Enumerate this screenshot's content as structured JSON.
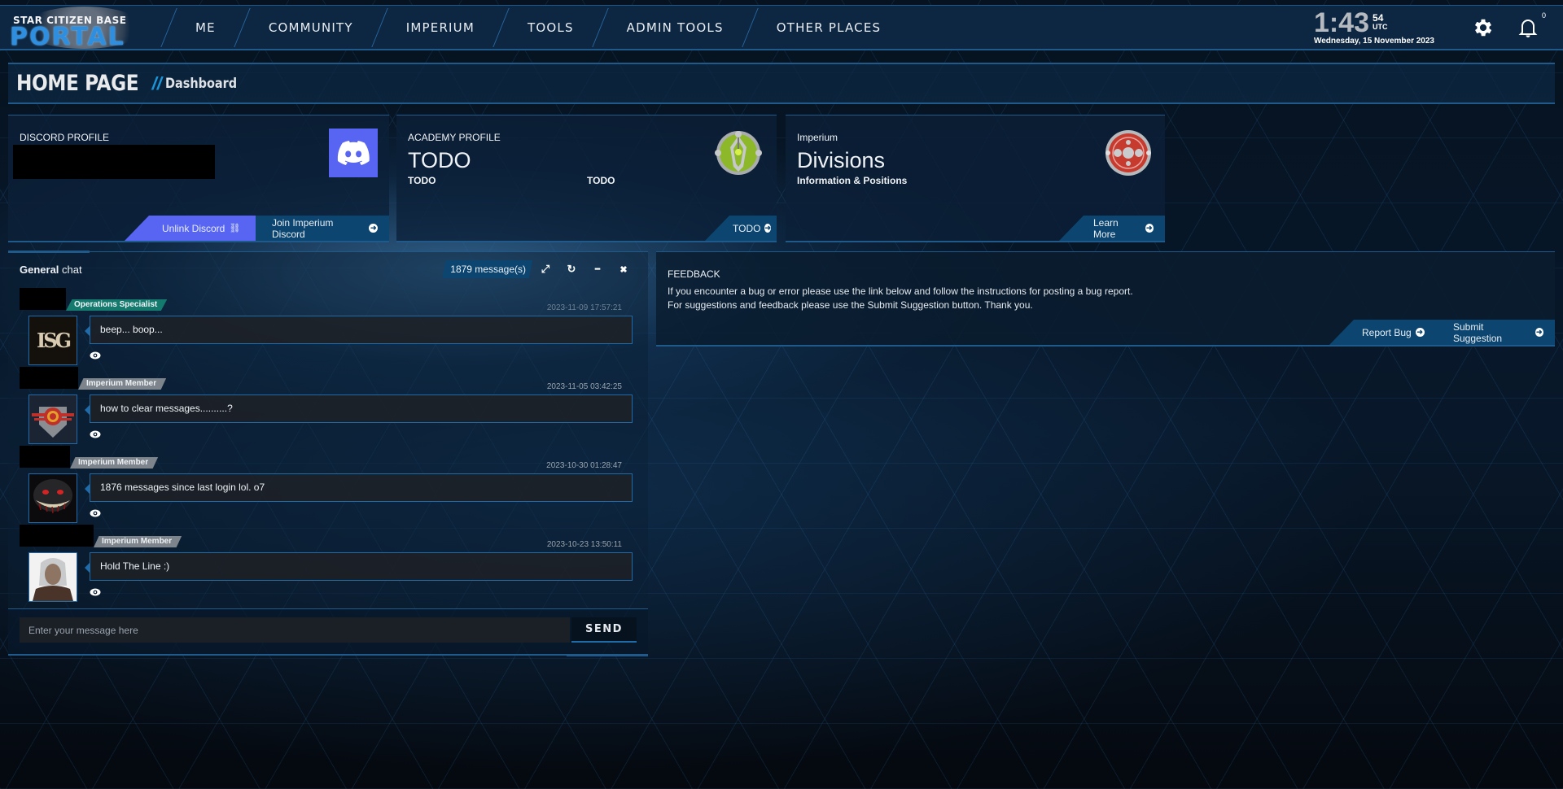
{
  "nav": {
    "logo_top": "STAR CITIZEN BASE",
    "logo_main": "PORTAL",
    "items": [
      {
        "label": "ME"
      },
      {
        "label": "COMMUNITY"
      },
      {
        "label": "IMPERIUM"
      },
      {
        "label": "TOOLS"
      },
      {
        "label": "ADMIN TOOLS"
      },
      {
        "label": "OTHER PLACES"
      }
    ],
    "clock": {
      "hm": "1:43",
      "seconds": "54",
      "tz": "UTC",
      "date": "Wednesday, 15 November 2023"
    },
    "settings_icon": "gear-icon",
    "notifications_icon": "bell-icon",
    "notification_count": "0"
  },
  "header": {
    "title": "HOME PAGE",
    "separator": "//",
    "subtitle": "Dashboard"
  },
  "cards": {
    "discord": {
      "label": "DISCORD PROFILE",
      "icon": "discord-icon",
      "buttons": [
        {
          "label": "Unlink Discord",
          "icon": "unlink-icon"
        },
        {
          "label": "Join Imperium Discord",
          "icon": "arrow-circle-right-icon"
        }
      ]
    },
    "academy": {
      "label": "ACADEMY PROFILE",
      "big": "TODO",
      "sub_left": "TODO",
      "sub_right": "TODO",
      "icon": "academy-emblem-icon",
      "button": {
        "label": "TODO",
        "icon": "arrow-circle-right-icon"
      }
    },
    "divisions": {
      "label": "Imperium",
      "big": "Divisions",
      "sub": "Information & Positions",
      "icon": "divisions-emblem-icon",
      "button": {
        "label": "Learn More",
        "icon": "arrow-circle-right-icon"
      }
    }
  },
  "chat": {
    "title_bold": "General",
    "title_rest": " chat",
    "message_count": "1879 message(s)",
    "tools": [
      {
        "name": "expand-icon",
        "glyph": "⤢"
      },
      {
        "name": "refresh-icon",
        "glyph": "↻"
      },
      {
        "name": "minimize-icon",
        "glyph": "━"
      },
      {
        "name": "close-icon",
        "glyph": "✖"
      }
    ],
    "messages": [
      {
        "role": "Operations Specialist",
        "role_color": "#157a6e",
        "time": "2023-11-09 17:57:21",
        "text": "beep... boop...",
        "avatar": "avatar-isg-logo"
      },
      {
        "role": "Imperium Member",
        "role_color": "#7d848b",
        "time": "2023-11-05 03:42:25",
        "text": "how to clear messages..........?",
        "avatar": "avatar-imperium-shield"
      },
      {
        "role": "Imperium Member",
        "role_color": "#7d848b",
        "time": "2023-10-30 01:28:47",
        "text": "1876 messages since last login lol. o7",
        "avatar": "avatar-grinning-cat"
      },
      {
        "role": "Imperium Member",
        "role_color": "#7d848b",
        "time": "2023-10-23 13:50:11",
        "text": "Hold The Line :)",
        "avatar": "avatar-geralt"
      }
    ],
    "input_placeholder": "Enter your message here",
    "input_value": "",
    "send_label": "SEND"
  },
  "feedback": {
    "title": "FEEDBACK",
    "line1": "If you encounter a bug or error please use the link below and follow the instructions for posting a bug report.",
    "line2": "For suggestions and feedback please use the Submit Suggestion button. Thank you.",
    "buttons": [
      {
        "label": "Report Bug",
        "icon": "arrow-circle-right-icon"
      },
      {
        "label": "Submit Suggestion",
        "icon": "arrow-circle-right-icon"
      }
    ]
  },
  "colors": {
    "accent_blue": "#1f5a8a",
    "button_blue": "#0c4670",
    "discord_blurple": "#5865f2",
    "role_ops": "#157a6e",
    "role_member": "#7d848b"
  }
}
